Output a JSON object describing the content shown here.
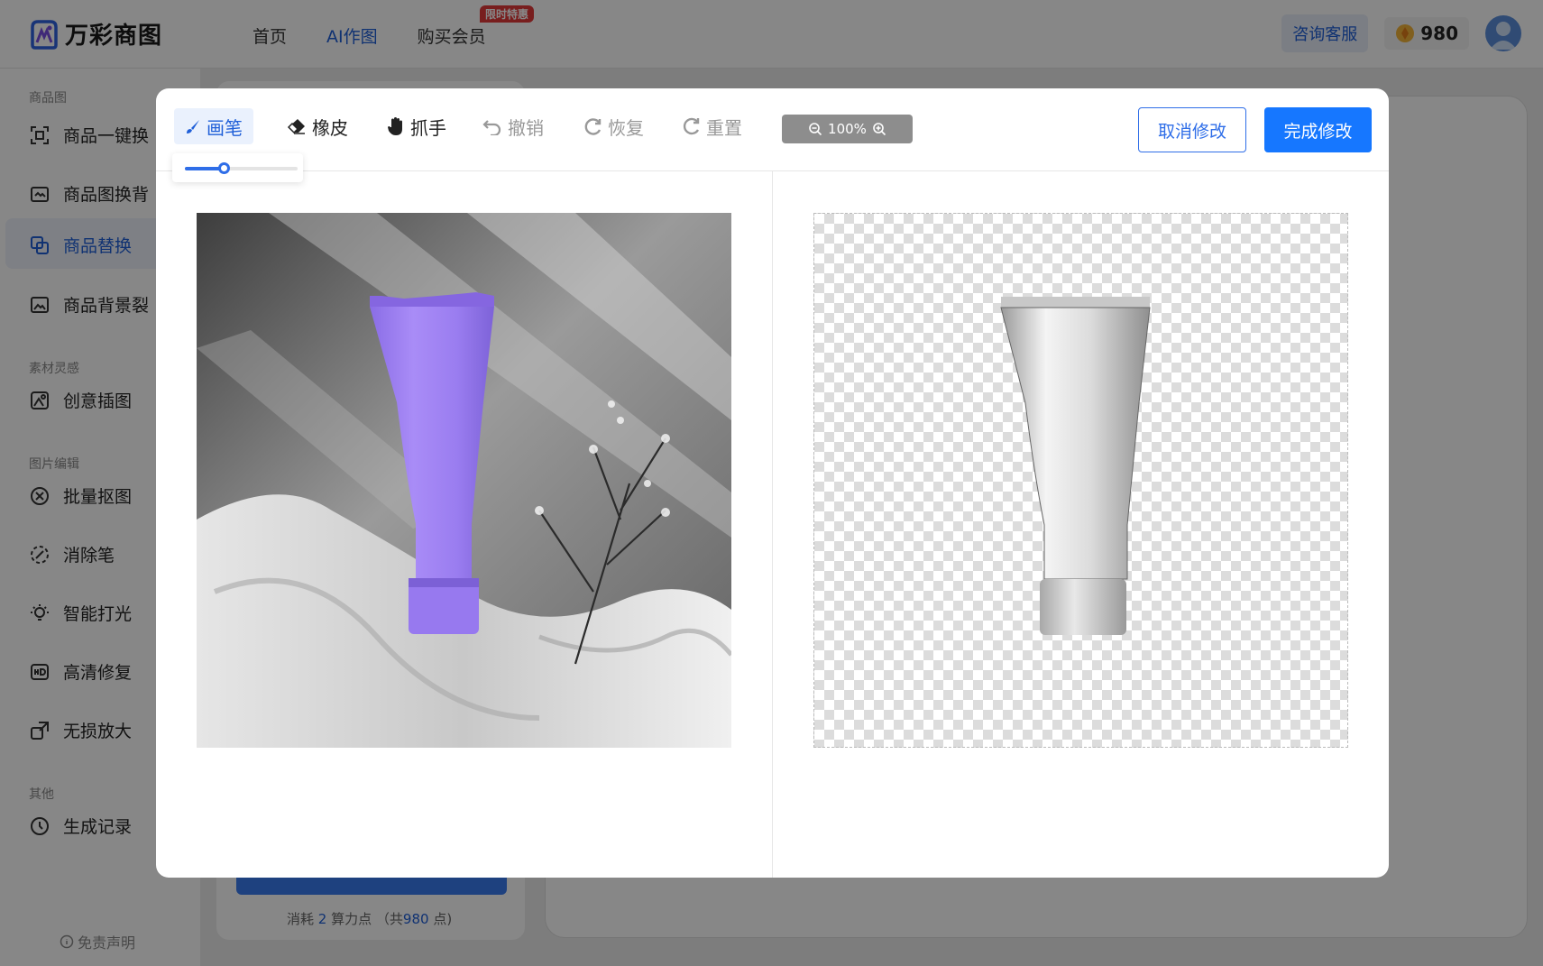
{
  "header": {
    "brand": "万彩商图",
    "nav": [
      "首页",
      "AI作图",
      "购买会员"
    ],
    "promo_badge": "限时特惠",
    "consult": "咨询客服",
    "points": "980"
  },
  "sidebar": {
    "sections": [
      "商品图",
      "素材灵感",
      "图片编辑",
      "其他"
    ],
    "items": [
      "商品一键换",
      "商品图换背",
      "商品替换",
      "商品背景裂",
      "创意插图",
      "批量抠图",
      "消除笔",
      "智能打光",
      "高清修复",
      "无损放大",
      "生成记录"
    ],
    "active_index": 2,
    "disclaimer": "免责声明"
  },
  "background_panel": {
    "consume_prefix": "消耗",
    "consume_value": "2",
    "consume_mid": "算力点 （共",
    "consume_total": "980",
    "consume_suffix": "点)"
  },
  "editor": {
    "tools": [
      "画笔",
      "橡皮",
      "抓手",
      "撤销",
      "恢复",
      "重置"
    ],
    "active_tool": "画笔",
    "brush_size_fraction": 0.34,
    "zoom": "100%",
    "cancel": "取消修改",
    "done": "完成修改"
  },
  "colors": {
    "accent": "#1677ff",
    "mask": "#9b7ef0"
  },
  "icons": {
    "brush": "brush-icon",
    "eraser": "eraser-icon",
    "hand": "hand-icon",
    "undo": "undo-icon",
    "redo": "redo-icon",
    "reset": "reset-icon",
    "zoom_out": "zoom-out-icon",
    "zoom_in": "zoom-in-icon"
  }
}
